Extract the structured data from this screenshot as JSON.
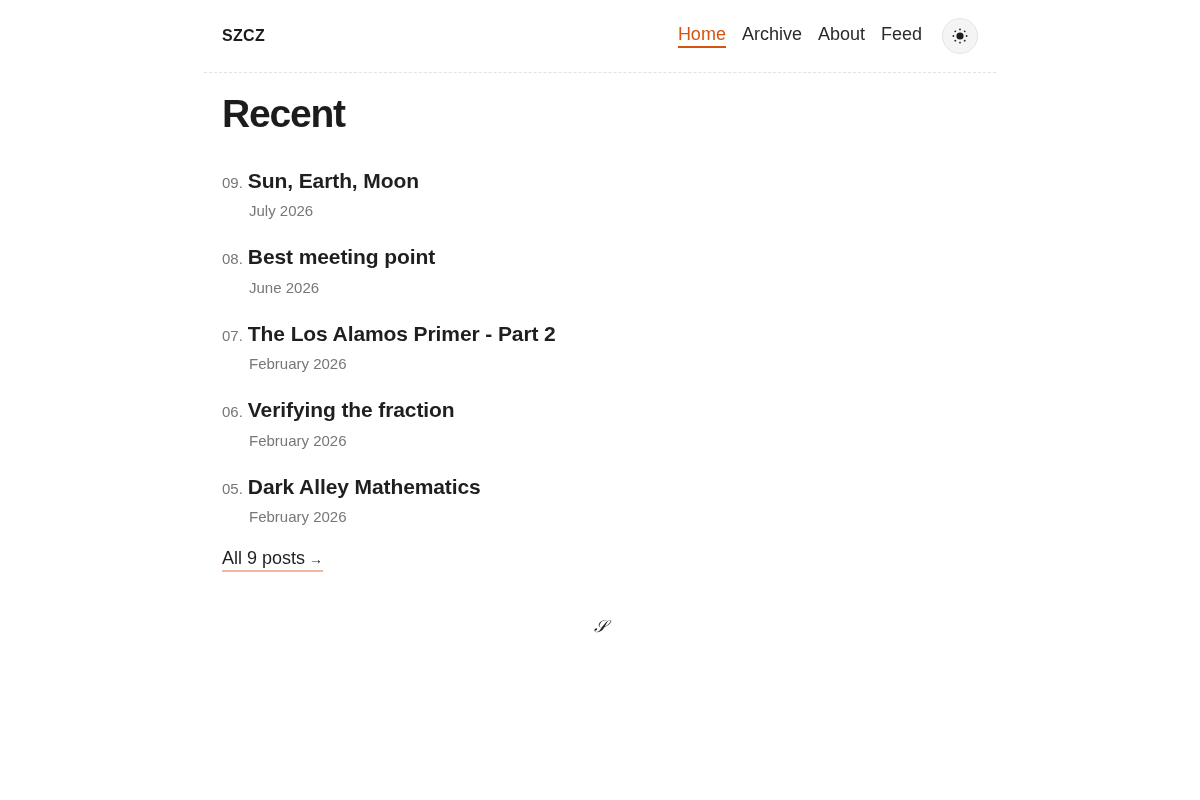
{
  "header": {
    "brand": "SZCZ",
    "nav": [
      {
        "label": "Home",
        "selected": true
      },
      {
        "label": "Archive",
        "selected": false
      },
      {
        "label": "About",
        "selected": false
      },
      {
        "label": "Feed",
        "selected": false
      }
    ]
  },
  "heading": "Recent",
  "posts": [
    {
      "number": "09.",
      "title": "Sun, Earth, Moon",
      "date": "July 2026"
    },
    {
      "number": "08.",
      "title": "Best meeting point",
      "date": "June 2026"
    },
    {
      "number": "07.",
      "title": "The Los Alamos Primer - Part 2",
      "date": "February 2026"
    },
    {
      "number": "06.",
      "title": "Verifying the fraction",
      "date": "February 2026"
    },
    {
      "number": "05.",
      "title": "Dark Alley Mathematics",
      "date": "February 2026"
    }
  ],
  "all_posts_link": {
    "label": "All 9 posts",
    "arrow": "→"
  },
  "footer": {
    "mark": "𝒮"
  }
}
